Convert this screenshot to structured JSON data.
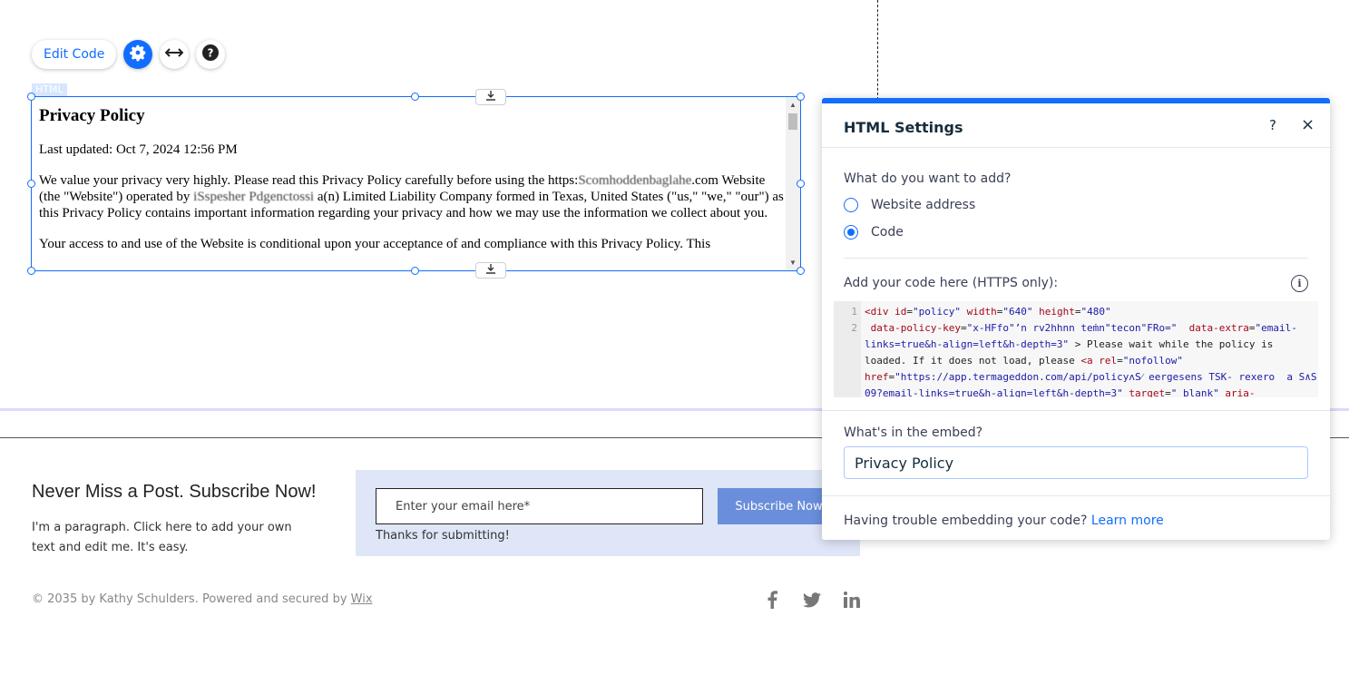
{
  "toolbar": {
    "edit_code_label": "Edit Code",
    "settings_icon": "gear-icon",
    "stretch_icon": "horizontal-arrows-icon",
    "help_icon": "question-icon"
  },
  "element_tag": "HTML",
  "embed": {
    "heading": "Privacy Policy",
    "updated": "Last updated: Oct 7, 2024 12:56 PM",
    "para1_a": "We value your privacy very highly. Please read this Privacy Policy carefully before using the https:",
    "para1_redacted_domain": "Scomhoddenbaglahe",
    "para1_b": ".com Website (the \"Website\") operated by ",
    "para1_redacted_name": "iSspesher Pdgenctossi",
    "para1_c": " a(n) Limited Liability Company formed in Texas, United States (\"us,\" \"we,\" \"our\") as this Privacy Policy contains important information regarding your privacy and how we may use the information we collect about you.",
    "para2": "Your access to and use of the Website is conditional upon your acceptance of and compliance with this Privacy Policy. This"
  },
  "subscribe": {
    "title": "Never Miss a Post. Subscribe Now!",
    "text": "I'm a paragraph. Click here to add your own text and edit me. It's easy.",
    "email_placeholder": "Enter your email here*",
    "button_label": "Subscribe Now",
    "thanks": "Thanks for submitting!"
  },
  "footer": {
    "copyright": "© 2035 by Kathy Schulders. Powered and secured by ",
    "wix_link": "Wix",
    "social_icons": [
      "facebook-icon",
      "twitter-icon",
      "linkedin-icon"
    ]
  },
  "panel": {
    "title": "HTML Settings",
    "help": "?",
    "close": "×",
    "question": "What do you want to add?",
    "options": [
      {
        "label": "Website address",
        "checked": false
      },
      {
        "label": "Code",
        "checked": true
      }
    ],
    "code_label": "Add your code here (HTTPS only):",
    "info": "i",
    "line_numbers": [
      "1",
      "2"
    ],
    "embed_label": "What's in the embed?",
    "embed_value": "Privacy Policy",
    "trouble_text": "Having trouble embedding your code?",
    "learn_more": "Learn more"
  },
  "colors": {
    "accent": "#116dff",
    "subscribe_bg": "#dfe6f7",
    "subscribe_btn": "#6a8edb",
    "purple_divider": "#dcd8ff"
  }
}
